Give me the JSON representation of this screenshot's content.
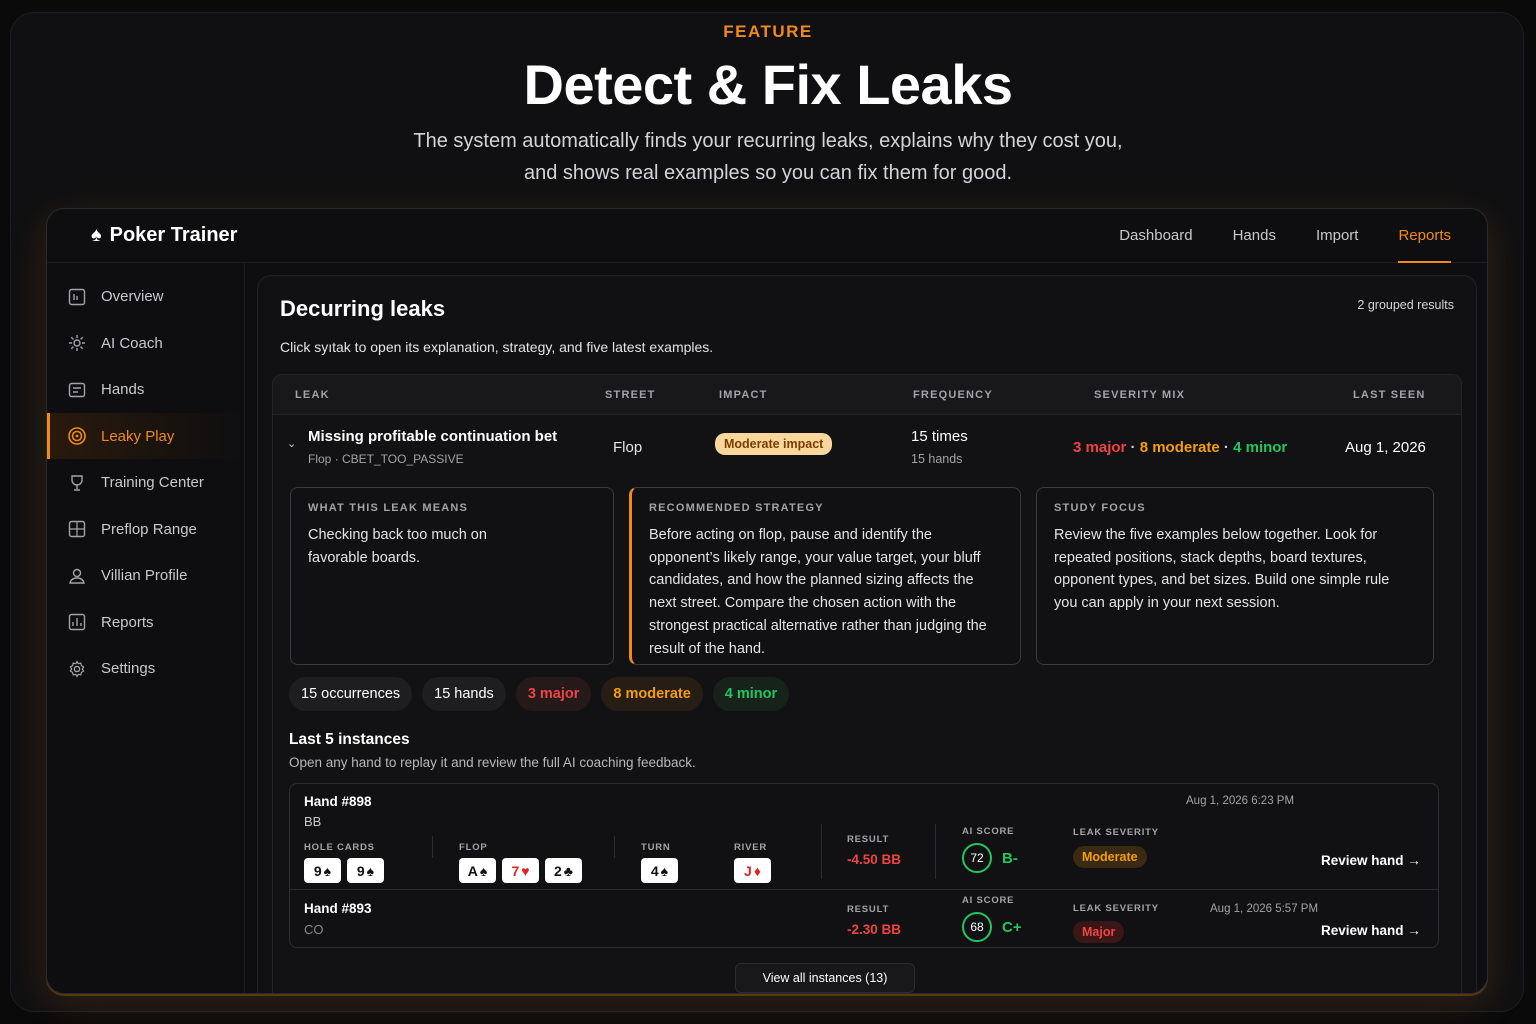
{
  "hero": {
    "eyebrow": "FEATURE",
    "title": "Detect & Fix Leaks",
    "subtitle_line1": "The system automatically finds your recurring leaks, explains why they cost you,",
    "subtitle_line2": "and shows real examples so you can fix them for good."
  },
  "app": {
    "brand_icon": "spade-icon",
    "brand_name": "Poker Trainer",
    "topnav": [
      "Dashboard",
      "Hands",
      "Import",
      "Reports"
    ],
    "topnav_active": "Reports",
    "sidebar": [
      {
        "label": "Overview",
        "icon": "overview-icon"
      },
      {
        "label": "AI Coach",
        "icon": "ai-coach-icon"
      },
      {
        "label": "Hands",
        "icon": "hands-icon"
      },
      {
        "label": "Leaky Play",
        "icon": "target-icon",
        "active": true
      },
      {
        "label": "Training Center",
        "icon": "trophy-icon"
      },
      {
        "label": "Preflop Range",
        "icon": "range-grid-icon"
      },
      {
        "label": "Villian Profile",
        "icon": "user-icon"
      },
      {
        "label": "Reports",
        "icon": "reports-icon"
      },
      {
        "label": "Settings",
        "icon": "gear-icon"
      }
    ]
  },
  "panel": {
    "title": "Decurring leaks",
    "count": "2 grouped results",
    "description": "Click syıtak to open its explanation, strategy, and five latest examples."
  },
  "table": {
    "headers": {
      "leak": "LEAK",
      "street": "STREET",
      "impact": "IMPACT",
      "frequency": "FREQUENCY",
      "severity_mix": "SEVERITY MIX",
      "last_seen": "LAST SEEN"
    },
    "row": {
      "name": "Missing profitable continuation bet",
      "meta": "Flop · CBET_TOO_PASSIVE",
      "street": "Flop",
      "impact": "Moderate impact",
      "frequency_main": "15 times",
      "frequency_sub": "15 hands",
      "severity_major": "3 major",
      "severity_moderate": "8 moderate",
      "severity_minor": "4 minor",
      "severity_sep": "·",
      "last_seen": "Aug 1, 2026"
    }
  },
  "cards": {
    "meaning_label": "WHAT THIS LEAK MEANS",
    "meaning_body": "Checking back too much on favorable boards.",
    "strategy_label": "RECOMMENDED STRATEGY",
    "strategy_body": "Before acting on flop, pause and identify the opponent’s likely range, your value target, your bluff candidates, and how the planned sizing affects the next street. Compare the chosen action with the strongest practical alternative rather than judging the result of the hand.",
    "study_label": "STUDY FOCUS",
    "study_body": "Review the five examples below together. Look for repeated positions, stack depths, board textures, opponent types, and bet sizes. Build one simple rule you can apply in your next session."
  },
  "pills": {
    "occurrences": "15 occurrences",
    "hands": "15 hands",
    "major": "3 major",
    "moderate": "8 moderate",
    "minor": "4 minor"
  },
  "instances": {
    "title": "Last 5 instances",
    "description": "Open any hand to replay it and review the full AI coaching feedback.",
    "labels": {
      "hole_cards": "HOLE CARDS",
      "flop": "FLOP",
      "turn": "TURN",
      "river": "RIVER",
      "result": "RESULT",
      "ai_score": "AI SCORE",
      "leak_severity": "LEAK SEVERITY",
      "review": "Review hand →"
    },
    "hands": [
      {
        "id": "Hand #898",
        "position": "BB",
        "time": "Aug 1, 2026 6:23 PM",
        "hole": [
          {
            "rank": "9",
            "suit": "♠"
          },
          {
            "rank": "9",
            "suit": "♠"
          }
        ],
        "flop": [
          {
            "rank": "A",
            "suit": "♠"
          },
          {
            "rank": "7",
            "suit": "♥"
          },
          {
            "rank": "2",
            "suit": "♣"
          }
        ],
        "turn": [
          {
            "rank": "4",
            "suit": "♠"
          }
        ],
        "river": [
          {
            "rank": "J",
            "suit": "♦"
          }
        ],
        "result": "-4.50 BB",
        "score": "72",
        "grade": "B-",
        "severity": "Moderate"
      },
      {
        "id": "Hand #893",
        "position": "CO",
        "time": "Aug 1, 2026 5:57 PM",
        "result": "-2.30 BB",
        "score": "68",
        "grade": "C+",
        "severity": "Major"
      }
    ],
    "view_all": "View all instances (13)"
  }
}
